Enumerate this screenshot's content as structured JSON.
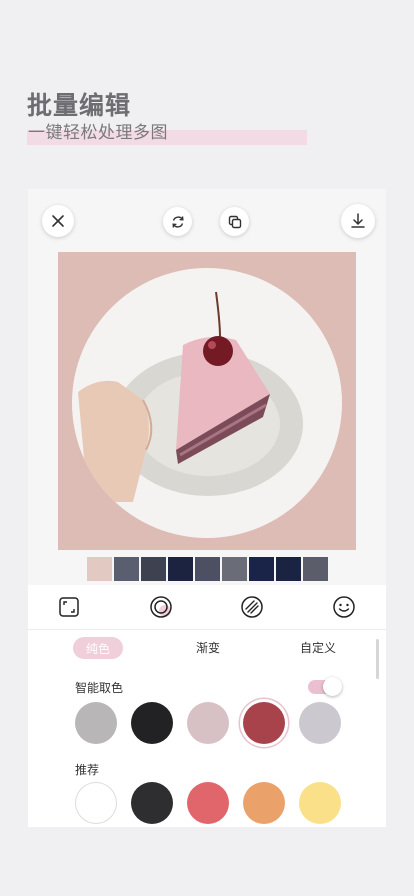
{
  "hero": {
    "title": "批量编辑",
    "subtitle": "一键轻松处理多图"
  },
  "top_buttons": {
    "close": "close-icon",
    "rotate": "rotate-icon",
    "copy": "copy-icon",
    "download": "download-icon"
  },
  "toolbar": {
    "tools": [
      "crop-frame-icon",
      "background-circle-icon",
      "texture-icon",
      "sticker-smile-icon"
    ]
  },
  "tabs": {
    "solid": "纯色",
    "gradient": "渐变",
    "custom": "自定义"
  },
  "smart_pick": {
    "label": "智能取色",
    "enabled": true,
    "colors": [
      "#b8b6b6",
      "#222224",
      "#d8c1c5",
      "#a8434c",
      "#cbc8cf"
    ],
    "selected_index": 3
  },
  "recommended": {
    "label": "推荐",
    "colors": [
      "#ffffff",
      "#2e2e30",
      "#e0666b",
      "#eba16a",
      "#fbe08a"
    ]
  },
  "colors": {
    "accent_pink": "#f0cfdb",
    "canvas_bg": "#dcbcb4"
  }
}
